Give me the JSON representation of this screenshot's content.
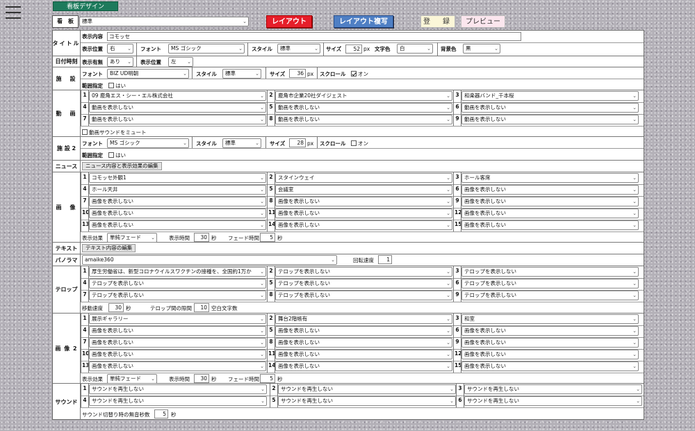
{
  "menu_icon": "hamburger-icon",
  "page_tab": "看板デザイン",
  "top": {
    "label": "看　板",
    "selected": "標準",
    "layout_btn": "レイアウト",
    "copy_btn": "レイアウト複写",
    "register_btn": "登　録",
    "preview_btn": "プレビュー"
  },
  "title_sec": {
    "label": "タイトル",
    "content_label": "表示内容",
    "content": "コモッセ",
    "pos_label": "表示位置",
    "pos": "右",
    "font_label": "フォント",
    "font": "MS ゴシック",
    "style_label": "スタイル",
    "style": "標準",
    "size_label": "サイズ",
    "size": "52",
    "px": "px",
    "color_label": "文字色",
    "color": "白",
    "bg_label": "背景色",
    "bg": "黒"
  },
  "datetime": {
    "label": "日付時刻",
    "show_label": "表示有無",
    "show": "あり",
    "pos_label": "表示位置",
    "pos": "左"
  },
  "facility": {
    "label": "施　設",
    "font_label": "フォント",
    "font": "BIZ UD明朝",
    "style_label": "スタイル",
    "style": "標準",
    "size_label": "サイズ",
    "size": "36",
    "px": "px",
    "scroll_label": "スクロール",
    "scroll": "オン",
    "range_label": "範囲指定",
    "range": "はい"
  },
  "video": {
    "label": "動　画",
    "items": [
      "09 鹿角エス・シー・エル株式会社",
      "鹿角市企業20社ダイジェスト",
      "和楽器バンド_千本桜",
      "動画を表示しない",
      "動画を表示しない",
      "動画を表示しない",
      "動画を表示しない",
      "動画を表示しない",
      "動画を表示しない"
    ],
    "mute": "動画サウンドをミュート"
  },
  "facility2": {
    "label": "施 設 2",
    "font_label": "フォント",
    "font": "MS ゴシック",
    "style_label": "スタイル",
    "style": "標準",
    "size_label": "サイズ",
    "size": "28",
    "px": "px",
    "scroll_label": "スクロール",
    "scroll": "オン",
    "range_label": "範囲指定",
    "range": "はい"
  },
  "news": {
    "label": "ニュース",
    "button": "ニュース内容と表示効果の編集"
  },
  "image": {
    "label": "画　像",
    "items": [
      "コモッセ外観1",
      "スタインウェイ",
      "ホール客席",
      "ホール天井",
      "会議室",
      "画像を表示しない",
      "画像を表示しない",
      "画像を表示しない",
      "画像を表示しない",
      "画像を表示しない",
      "画像を表示しない",
      "画像を表示しない",
      "画像を表示しない",
      "画像を表示しない",
      "画像を表示しない"
    ],
    "effect_label": "表示効果",
    "effect": "単純フェード",
    "time_label": "表示時間",
    "time": "30",
    "sec": "秒",
    "fade_label": "フェード時間",
    "fade": "5"
  },
  "text": {
    "label": "テキスト",
    "button": "テキスト内容の編集"
  },
  "panorama": {
    "label": "パノラマ",
    "selected": "amaike360",
    "speed_label": "回転速度",
    "speed": "1"
  },
  "telop": {
    "label": "テロップ",
    "items": [
      "厚生労働省は、新型コロナウイルスワクチンの接種を、全国約1万か",
      "テロップを表示しない",
      "テロップを表示しない",
      "テロップを表示しない",
      "テロップを表示しない",
      "テロップを表示しない",
      "テロップを表示しない",
      "テロップを表示しない",
      "テロップを表示しない"
    ],
    "move_label": "移動速度",
    "move": "30",
    "sec": "秒",
    "gap_label": "テロップ間の隙間",
    "gap": "10",
    "gap_unit": "空白文字数"
  },
  "image2": {
    "label": "画 像 2",
    "items": [
      "展示ギャラリー",
      "舞台2階帳有",
      "和室",
      "画像を表示しない",
      "画像を表示しない",
      "画像を表示しない",
      "画像を表示しない",
      "画像を表示しない",
      "画像を表示しない",
      "画像を表示しない",
      "画像を表示しない",
      "画像を表示しない",
      "画像を表示しない",
      "画像を表示しない",
      "画像を表示しない"
    ],
    "effect_label": "表示効果",
    "effect": "単純フェード",
    "time_label": "表示時間",
    "time": "30",
    "sec": "秒",
    "fade_label": "フェード時間",
    "fade": "5"
  },
  "sound": {
    "label": "サウンド",
    "items": [
      "サウンドを再生しない",
      "サウンドを再生しない",
      "サウンドを再生しない",
      "サウンドを再生しない",
      "サウンドを再生しない",
      "サウンドを再生しない"
    ],
    "silence_label": "サウンド切替り時の無音秒数",
    "silence": "5",
    "sec": "秒"
  },
  "nums": [
    "1",
    "2",
    "3",
    "4",
    "5",
    "6",
    "7",
    "8",
    "9",
    "10",
    "11",
    "12",
    "13",
    "14",
    "15"
  ]
}
